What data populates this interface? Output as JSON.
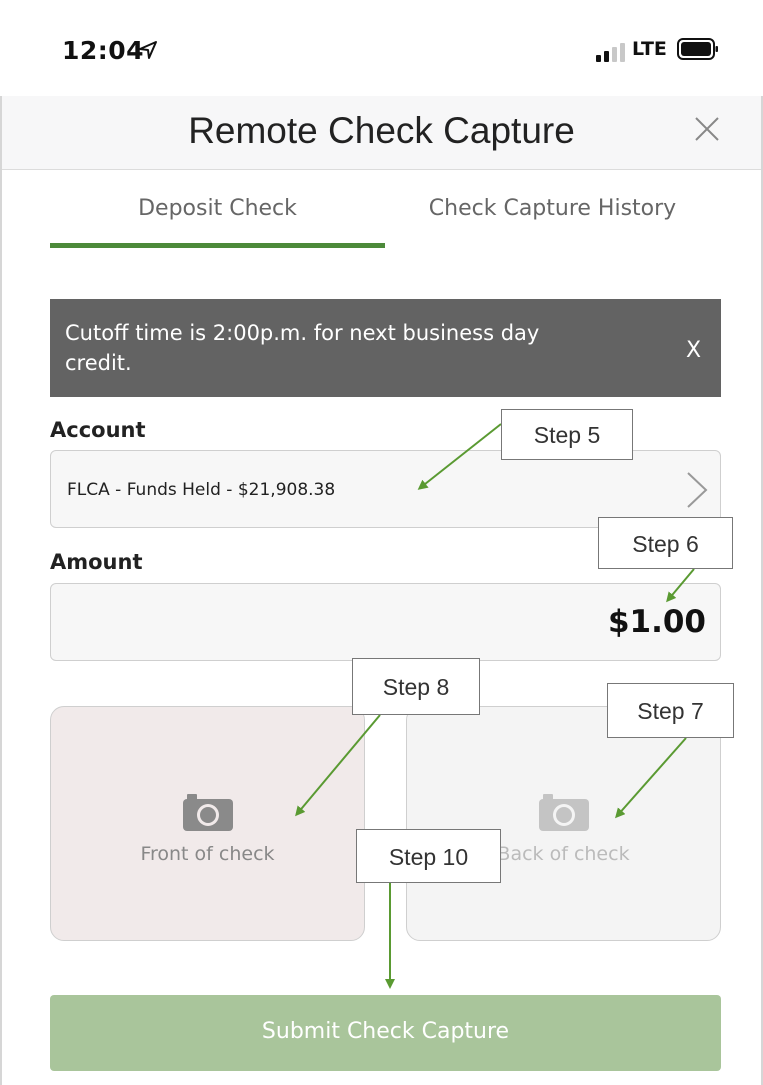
{
  "status_bar": {
    "time": "12:04",
    "network": "LTE"
  },
  "header": {
    "title": "Remote Check Capture"
  },
  "tabs": [
    {
      "label": "Deposit Check",
      "active": true
    },
    {
      "label": "Check Capture History",
      "active": false
    }
  ],
  "banner": {
    "text": "Cutoff time is 2:00p.m. for next business day credit.",
    "close_label": "X"
  },
  "account": {
    "label": "Account",
    "value": "FLCA - Funds Held - $21,908.38"
  },
  "amount": {
    "label": "Amount",
    "value": "$1.00"
  },
  "capture": {
    "front_label": "Front of check",
    "back_label": "Back of check"
  },
  "submit": {
    "label": "Submit Check Capture"
  },
  "annotations": {
    "step5": "Step 5",
    "step6": "Step 6",
    "step7": "Step 7",
    "step8": "Step 8",
    "step10": "Step 10"
  },
  "colors": {
    "accent": "#4c8a3a",
    "banner": "#636363",
    "submit": "#a9c59b",
    "annotation_arrow": "#5a9a32"
  }
}
